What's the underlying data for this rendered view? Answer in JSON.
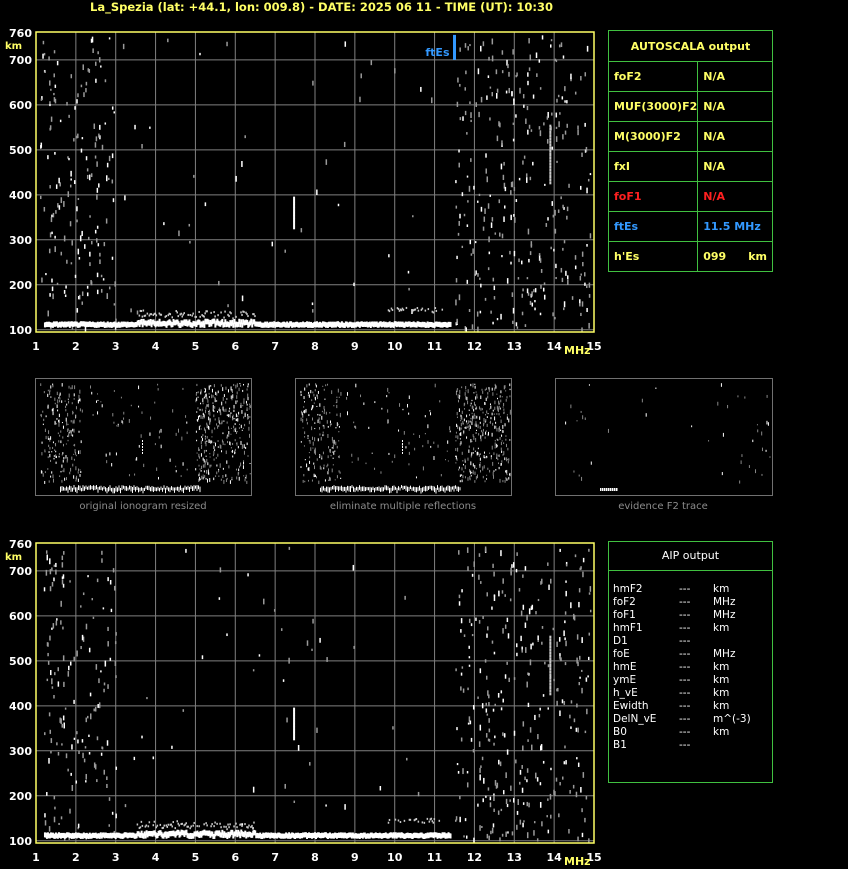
{
  "title": "La_Spezia (lat: +44.1, lon: 009.8) - DATE: 2025 06 11 - TIME (UT): 10:30",
  "colors": {
    "grid": "#808080",
    "axis": "#ffff66",
    "panel_border": "#40c040",
    "ftes": "#3399ff",
    "fof1": "#ff2020",
    "normal_label": "#ffff66"
  },
  "chart_data": [
    {
      "type": "scatter",
      "title": "",
      "xlabel": "MHz",
      "ylabel": "km",
      "xlim": [
        1,
        15
      ],
      "ylim": [
        95,
        762
      ],
      "x_ticks": [
        1,
        2,
        3,
        4,
        5,
        6,
        7,
        8,
        9,
        10,
        11,
        12,
        13,
        14,
        15
      ],
      "y_ticks": [
        100,
        200,
        300,
        400,
        500,
        600,
        700,
        760
      ],
      "grid": true,
      "trace_es": {
        "x_start": 1.2,
        "x_end": 11.4,
        "height_km": 115
      },
      "marker": {
        "label": "ftEs",
        "x": 11.5,
        "y_from": 700,
        "y_to": 760
      }
    },
    {
      "type": "scatter",
      "title": "",
      "xlabel": "MHz",
      "ylabel": "km",
      "xlim": [
        1,
        15
      ],
      "ylim": [
        95,
        762
      ],
      "x_ticks": [
        1,
        2,
        3,
        4,
        5,
        6,
        7,
        8,
        9,
        10,
        11,
        12,
        13,
        14,
        15
      ],
      "y_ticks": [
        100,
        200,
        300,
        400,
        500,
        600,
        700,
        760
      ],
      "grid": true,
      "trace_es": {
        "x_start": 1.2,
        "x_end": 11.4,
        "height_km": 115
      }
    }
  ],
  "thumbnails": [
    {
      "caption": "original ionogram resized"
    },
    {
      "caption": "eliminate multiple reflections"
    },
    {
      "caption": "evidence F2 trace"
    }
  ],
  "autoscala": {
    "header": "AUTOSCALA output",
    "rows": [
      {
        "label": "foF2",
        "value": "N/A",
        "unit": "",
        "color": "#ffff66"
      },
      {
        "label": "MUF(3000)F2",
        "value": "N/A",
        "unit": "",
        "color": "#ffff66"
      },
      {
        "label": "M(3000)F2",
        "value": "N/A",
        "unit": "",
        "color": "#ffff66"
      },
      {
        "label": "fxI",
        "value": "N/A",
        "unit": "",
        "color": "#ffff66"
      },
      {
        "label": "foF1",
        "value": "N/A",
        "unit": "",
        "color": "#ff2020"
      },
      {
        "label": "ftEs",
        "value": "11.5 MHz",
        "unit": "",
        "color": "#3399ff"
      },
      {
        "label": "h'Es",
        "value": "099",
        "unit": "km",
        "color": "#ffff66"
      }
    ]
  },
  "aip": {
    "header": "AIP output",
    "rows": [
      {
        "label": "hmF2",
        "value": "---",
        "unit": "km"
      },
      {
        "label": "foF2",
        "value": "---",
        "unit": "MHz"
      },
      {
        "label": "foF1",
        "value": "---",
        "unit": "MHz"
      },
      {
        "label": "hmF1",
        "value": "---",
        "unit": "km"
      },
      {
        "label": "D1",
        "value": "---",
        "unit": ""
      },
      {
        "label": "foE",
        "value": "---",
        "unit": "MHz"
      },
      {
        "label": "hmE",
        "value": "---",
        "unit": "km"
      },
      {
        "label": "ymE",
        "value": "---",
        "unit": "km"
      },
      {
        "label": "h_vE",
        "value": "---",
        "unit": "km"
      },
      {
        "label": "Ewidth",
        "value": "---",
        "unit": "km"
      },
      {
        "label": "DelN_vE",
        "value": "---",
        "unit": "m^(-3)"
      },
      {
        "label": "B0",
        "value": "---",
        "unit": "km"
      },
      {
        "label": "B1",
        "value": "---",
        "unit": ""
      }
    ]
  }
}
